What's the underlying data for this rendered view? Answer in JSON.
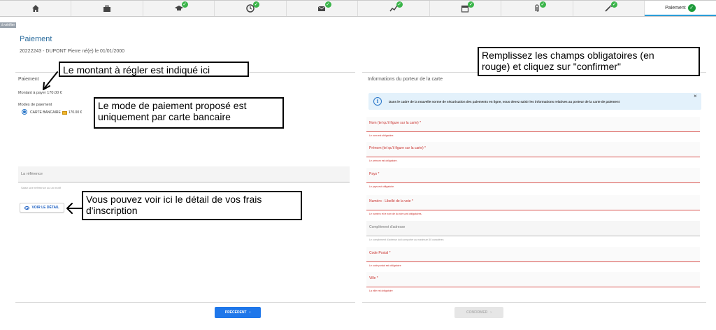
{
  "stepper": {
    "steps": [
      {
        "icon": "home-icon",
        "done": false
      },
      {
        "icon": "briefcase-icon",
        "done": false
      },
      {
        "icon": "graduation-cap-icon",
        "done": true
      },
      {
        "icon": "clock-icon",
        "done": true
      },
      {
        "icon": "envelope-icon",
        "done": true
      },
      {
        "icon": "chart-icon",
        "done": true
      },
      {
        "icon": "calendar-icon",
        "done": true
      },
      {
        "icon": "paperclip-icon",
        "done": true
      },
      {
        "icon": "wand-icon",
        "done": true
      }
    ],
    "active_label": "Paiement",
    "check_glyph": "✓"
  },
  "verifier_label": "à vérifier",
  "page": {
    "title": "Paiement",
    "student": "20222243 - DUPONT Pierre né(e) le 01/01/2000"
  },
  "payment": {
    "heading": "Paiement",
    "amount": "Montant à payer 170.00 €",
    "modes_heading": "Modes de paiement",
    "mode_option": "CARTE BANCAIRE",
    "mode_amount": "170.00 €",
    "reference_label": "La référence",
    "reference_hint": "Saisir une référence ou un motif",
    "detail_button": "VOIR LE DÉTAIL"
  },
  "card_holder": {
    "heading": "Informations du porteur de la carte",
    "info_text": "Dans le cadre de la nouvelle norme de sécurisation des paiements en ligne, vous devez saisir les informations relatives au porteur de la carte de paiement",
    "info_icon": "i",
    "close_glyph": "×",
    "fields": [
      {
        "label": "Nom (tel qu'il figure sur la carte) *",
        "hint": "Le nom est obligatoire.",
        "required": true
      },
      {
        "label": "Prénom (tel qu'il figure sur la carte) *",
        "hint": "Le prénom est obligatoire.",
        "required": true
      },
      {
        "label": "Pays *",
        "hint": "Le pays est obligatoire.",
        "required": true
      },
      {
        "label": "Numéro - Libellé de la voie *",
        "hint": "Le numéro et le nom de la voie sont obligatoires.",
        "required": true
      },
      {
        "label": "Complément d'adresse",
        "hint": "Le complément d'adresse doit comporter au maximum 50 caractères",
        "required": false
      },
      {
        "label": "Code Postal *",
        "hint": "Le code postal est obligatoire",
        "required": true
      },
      {
        "label": "Ville *",
        "hint": "La ville est obligatoire",
        "required": true
      }
    ]
  },
  "buttons": {
    "previous": "PRÉCÉDENT",
    "previous_glyph": "‹",
    "confirm": "CONFIRMER",
    "confirm_glyph": "›"
  },
  "callouts": {
    "amount": "Le montant à régler est indiqué ici",
    "mode_line1": "Le mode de paiement proposé est",
    "mode_line2": "uniquement par carte bancaire",
    "detail_line1": "Vous pouvez voir ici le détail de vos frais",
    "detail_line2": "d'inscription",
    "fields_line1": "Remplissez les champs obligatoires (en",
    "fields_line2": "rouge) et cliquez sur \"confirmer\""
  },
  "colors": {
    "primary": "#1f77ea",
    "required": "#c9302c",
    "success": "#3bb54a",
    "title": "#2f6f9f"
  }
}
